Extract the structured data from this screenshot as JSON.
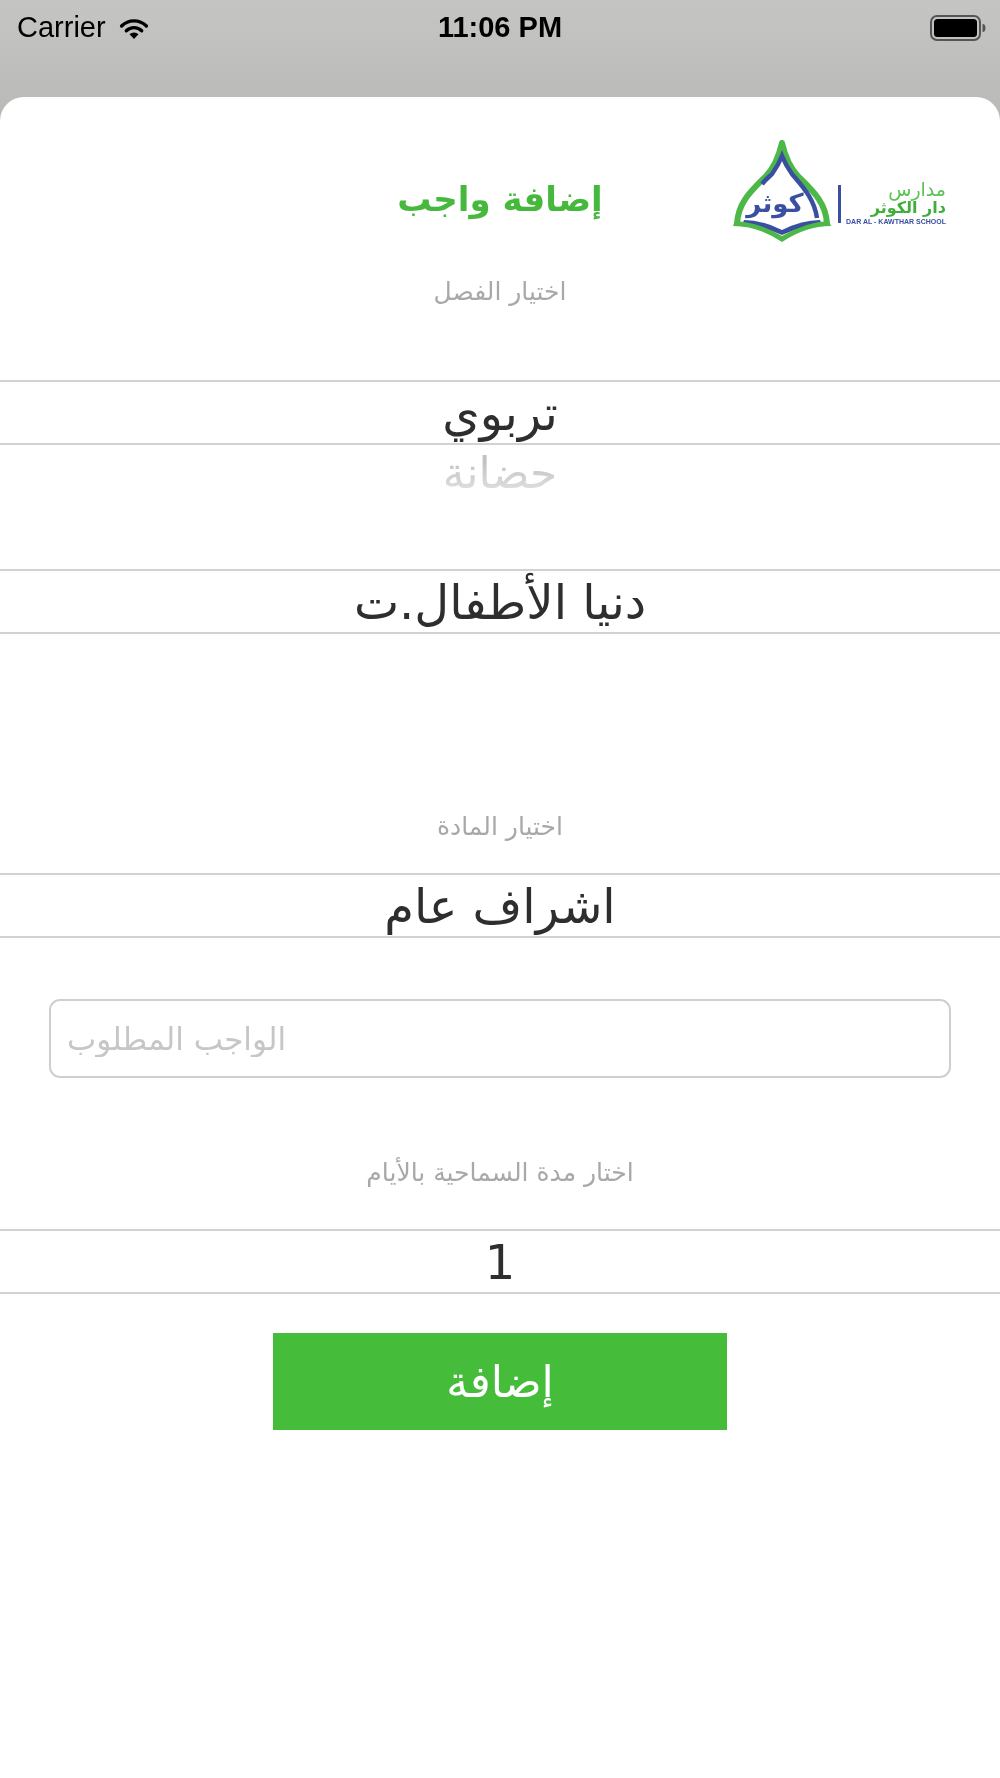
{
  "status_bar": {
    "carrier": "Carrier",
    "time": "11:06 PM"
  },
  "logo": {
    "emblem_text": "كوثر",
    "line_1": "مدارس",
    "line_2": "دار الكوثر",
    "line_latin": "DAR AL - KAWTHAR SCHOOL"
  },
  "title": "إضافة واجب",
  "class_section": {
    "label": "اختيار الفصل",
    "pickers": [
      {
        "value": "تربوي",
        "next_value": "حضانة"
      },
      {
        "value": "دنيا الأطفال.ت"
      }
    ]
  },
  "subject_section": {
    "label": "اختيار المادة",
    "pickers": [
      {
        "value": "اشراف عام"
      }
    ]
  },
  "homework_field": {
    "placeholder": "الواجب المطلوب"
  },
  "days_section": {
    "label": "اختار مدة السماحية بالأيام",
    "pickers": [
      {
        "value": "1"
      }
    ]
  },
  "submit_button": {
    "label": "إضافة"
  }
}
